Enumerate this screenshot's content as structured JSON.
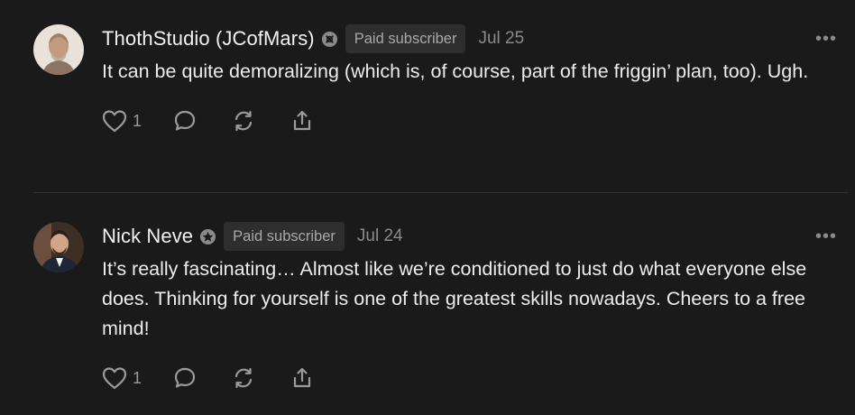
{
  "comments": [
    {
      "author": "ThothStudio (JCofMars)",
      "badge_icon": "subscriber-badge-icon",
      "pill": "Paid subscriber",
      "date": "Jul 25",
      "text": "It can be quite demoralizing (which is, of course, part of the friggin’ plan, too). Ugh.",
      "likes": "1",
      "more": "•••"
    },
    {
      "author": "Nick Neve",
      "badge_icon": "subscriber-badge-icon",
      "pill": "Paid subscriber",
      "date": "Jul 24",
      "text": "It’s really fascinating… Almost like we’re conditioned to just do what everyone else does. Thinking for yourself is one of the greatest skills nowadays. Cheers to a free mind!",
      "likes": "1",
      "more": "•••"
    }
  ]
}
